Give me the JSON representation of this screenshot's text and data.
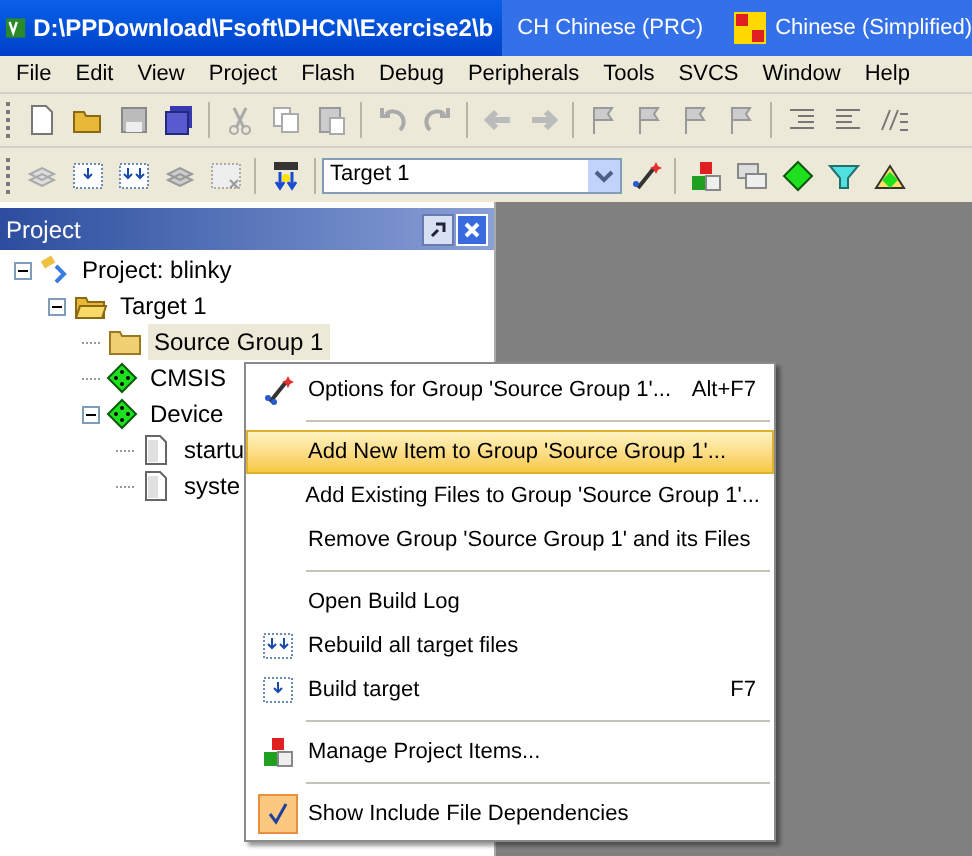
{
  "window": {
    "title": "D:\\PPDownload\\Fsoft\\DHCN\\Exercise2\\b"
  },
  "language_bar": {
    "input": "CH Chinese (PRC)",
    "layout": "Chinese (Simplified)"
  },
  "menu_bar": [
    "File",
    "Edit",
    "View",
    "Project",
    "Flash",
    "Debug",
    "Peripherals",
    "Tools",
    "SVCS",
    "Window",
    "Help"
  ],
  "toolbar": {
    "target": "Target 1"
  },
  "project_panel": {
    "title": "Project",
    "tree": [
      {
        "label": "Project: blinky",
        "kind": "project",
        "expanded": true,
        "selected": false,
        "children": [
          {
            "label": "Target 1",
            "kind": "target",
            "expanded": true,
            "selected": false,
            "children": [
              {
                "label": "Source Group 1",
                "kind": "folder",
                "selected": true
              },
              {
                "label": "CMSIS",
                "kind": "component",
                "selected": false
              },
              {
                "label": "Device",
                "kind": "component",
                "expanded": true,
                "selected": false,
                "children": [
                  {
                    "label": "startu",
                    "kind": "file",
                    "selected": false
                  },
                  {
                    "label": "syste",
                    "kind": "file",
                    "selected": false
                  }
                ]
              }
            ]
          }
        ]
      }
    ]
  },
  "context_menu": [
    {
      "kind": "item",
      "label": "Options for Group 'Source Group 1'...",
      "shortcut": "Alt+F7",
      "selected": false
    },
    {
      "kind": "separator"
    },
    {
      "kind": "item",
      "label": "Add New  Item to Group 'Source Group 1'...",
      "selected": true
    },
    {
      "kind": "item",
      "label": "Add Existing Files to Group 'Source Group 1'...",
      "selected": false
    },
    {
      "kind": "item",
      "label": "Remove Group 'Source Group 1' and its Files",
      "selected": false
    },
    {
      "kind": "separator"
    },
    {
      "kind": "item",
      "label": "Open Build Log",
      "selected": false
    },
    {
      "kind": "item",
      "label": "Rebuild all target files",
      "selected": false
    },
    {
      "kind": "item",
      "label": "Build target",
      "shortcut": "F7",
      "selected": false
    },
    {
      "kind": "separator"
    },
    {
      "kind": "item",
      "label": "Manage Project Items...",
      "selected": false
    },
    {
      "kind": "separator"
    },
    {
      "kind": "item",
      "label": "Show Include File Dependencies",
      "checked": true,
      "selected": false
    }
  ]
}
